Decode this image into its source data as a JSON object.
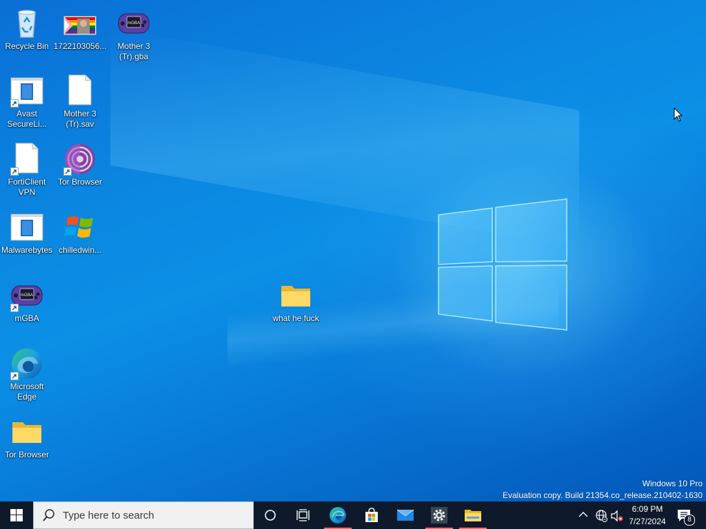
{
  "desktop": {
    "icons": [
      {
        "label": "Recycle Bin",
        "icon": "recycle-bin-icon"
      },
      {
        "label": "1722103056...",
        "icon": "image-file-icon"
      },
      {
        "label": "Mother 3 (Tr).gba",
        "icon": "gba-console-icon"
      },
      {
        "label": "Avast SecureLi...",
        "icon": "shortcut-app-icon"
      },
      {
        "label": "Mother 3 (Tr).sav",
        "icon": "blank-file-icon"
      },
      {
        "label": "FortiClient VPN",
        "icon": "blank-file-shortcut-icon"
      },
      {
        "label": "Tor Browser",
        "icon": "tor-browser-icon"
      },
      {
        "label": "Malwarebytes",
        "icon": "shortcut-app-icon"
      },
      {
        "label": "chilledwin...",
        "icon": "windows-xp-logo-icon"
      },
      {
        "label": "mGBA",
        "icon": "gba-console-icon"
      },
      {
        "label": "Microsoft Edge",
        "icon": "edge-icon"
      },
      {
        "label": "Tor Browser",
        "icon": "folder-icon"
      },
      {
        "label": "what he fuck",
        "icon": "folder-icon"
      }
    ]
  },
  "watermark": {
    "line1": "Windows 10 Pro",
    "line2": "Evaluation copy. Build 21354.co_release.210402-1630"
  },
  "taskbar": {
    "search_placeholder": "Type here to search",
    "pinned": [
      {
        "name": "Microsoft Edge",
        "icon": "edge-icon",
        "active": true
      },
      {
        "name": "Microsoft Store",
        "icon": "store-icon",
        "active": false
      },
      {
        "name": "Mail",
        "icon": "mail-icon",
        "active": false
      },
      {
        "name": "Settings",
        "icon": "gear-icon",
        "active": true
      },
      {
        "name": "File Explorer",
        "icon": "folder-icon",
        "active": true
      }
    ],
    "tray": {
      "time": "6:09 PM",
      "date": "7/27/2024",
      "notification_count": "8"
    }
  },
  "colors": {
    "taskbar": "#0e1a2c",
    "desktop_base": "#0b86e0",
    "active_indicator": "#f07070"
  }
}
